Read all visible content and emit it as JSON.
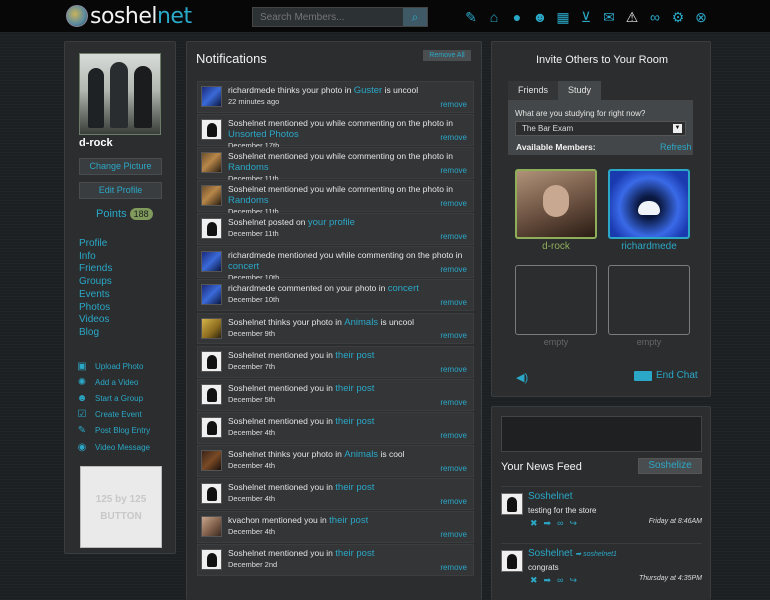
{
  "header": {
    "logo_part1": "soshel",
    "logo_part2": "net",
    "search_placeholder": "Search Members..."
  },
  "top_icons": [
    "wrench-icon",
    "home-icon",
    "user-icon",
    "group-icon",
    "calendar-icon",
    "cart-icon",
    "mail-icon",
    "alert-icon",
    "link-icon",
    "gear-icon",
    "close-icon"
  ],
  "profile": {
    "username": "d-rock",
    "change_picture": "Change Picture",
    "edit_profile": "Edit Profile",
    "points_label": "Points",
    "points_value": "188",
    "nav": [
      "Profile",
      "Info",
      "Friends",
      "Groups",
      "Events",
      "Photos",
      "Videos",
      "Blog"
    ],
    "actions": [
      {
        "icon": "upload-photo-icon",
        "label": "Upload Photo"
      },
      {
        "icon": "add-video-icon",
        "label": "Add a Video"
      },
      {
        "icon": "start-group-icon",
        "label": "Start a Group"
      },
      {
        "icon": "create-event-icon",
        "label": "Create Event"
      },
      {
        "icon": "pencil-icon",
        "label": "Post Blog Entry"
      },
      {
        "icon": "video-message-icon",
        "label": "Video Message"
      }
    ],
    "promo_line1": "125 by 125",
    "promo_line2": "BUTTON"
  },
  "notifications": {
    "title": "Notifications",
    "remove_all": "Remove All",
    "remove_label": "remove",
    "items": [
      {
        "thumb": "blue",
        "text": "richardmede thinks your photo in",
        "link": "Guster",
        "suffix": "is uncool",
        "date": "22 minutes ago"
      },
      {
        "thumb": "white",
        "text": "Soshelnet mentioned you while commenting on the photo in",
        "link": "Unsorted Photos",
        "suffix": "",
        "date": "December 17th"
      },
      {
        "thumb": "band",
        "text": "Soshelnet mentioned you while commenting on the photo in",
        "link": "Randoms",
        "suffix": "",
        "date": "December 11th"
      },
      {
        "thumb": "band",
        "text": "Soshelnet mentioned you while commenting on the photo in",
        "link": "Randoms",
        "suffix": "",
        "date": "December 11th"
      },
      {
        "thumb": "white",
        "text": "Soshelnet posted on",
        "link": "your profile",
        "suffix": "",
        "date": "December 11th"
      },
      {
        "thumb": "blue",
        "text": "richardmede mentioned you while commenting on the photo in",
        "link": "concert",
        "suffix": "",
        "date": "December 10th"
      },
      {
        "thumb": "blue",
        "text": "richardmede commented on your photo in",
        "link": "concert",
        "suffix": "",
        "date": "December 10th"
      },
      {
        "thumb": "yellow",
        "text": "Soshelnet thinks your photo in",
        "link": "Animals",
        "suffix": "is uncool",
        "date": "December 9th"
      },
      {
        "thumb": "white",
        "text": "Soshelnet mentioned you in",
        "link": "their post",
        "suffix": "",
        "date": "December 7th"
      },
      {
        "thumb": "white",
        "text": "Soshelnet mentioned you in",
        "link": "their post",
        "suffix": "",
        "date": "December 5th"
      },
      {
        "thumb": "white",
        "text": "Soshelnet mentioned you in",
        "link": "their post",
        "suffix": "",
        "date": "December 4th"
      },
      {
        "thumb": "dark",
        "text": "Soshelnet thinks your photo in",
        "link": "Animals",
        "suffix": "is cool",
        "date": "December 4th"
      },
      {
        "thumb": "white",
        "text": "Soshelnet mentioned you in",
        "link": "their post",
        "suffix": "",
        "date": "December 4th"
      },
      {
        "thumb": "face",
        "text": "kvachon mentioned you in",
        "link": "their post",
        "suffix": "",
        "date": "December 4th"
      },
      {
        "thumb": "white",
        "text": "Soshelnet mentioned you in",
        "link": "their post",
        "suffix": "",
        "date": "December 2nd"
      }
    ]
  },
  "room": {
    "title": "Invite Others to Your Room",
    "tab_friends": "Friends",
    "tab_study": "Study",
    "question": "What are you studying for right now?",
    "selected": "The Bar Exam",
    "available": "Available Members:",
    "refresh": "Refresh",
    "members": [
      "d-rock",
      "richardmede",
      "empty",
      "empty"
    ],
    "end_chat": "End Chat"
  },
  "feed": {
    "title": "Your News Feed",
    "button": "Soshelize",
    "items": [
      {
        "name": "Soshelnet",
        "to": "",
        "body": "testing for the store",
        "time": "Friday at 8:46AM"
      },
      {
        "name": "Soshelnet",
        "to": "soshelnet1",
        "body": "congrats",
        "time": "Thursday at 4:35PM"
      }
    ]
  }
}
